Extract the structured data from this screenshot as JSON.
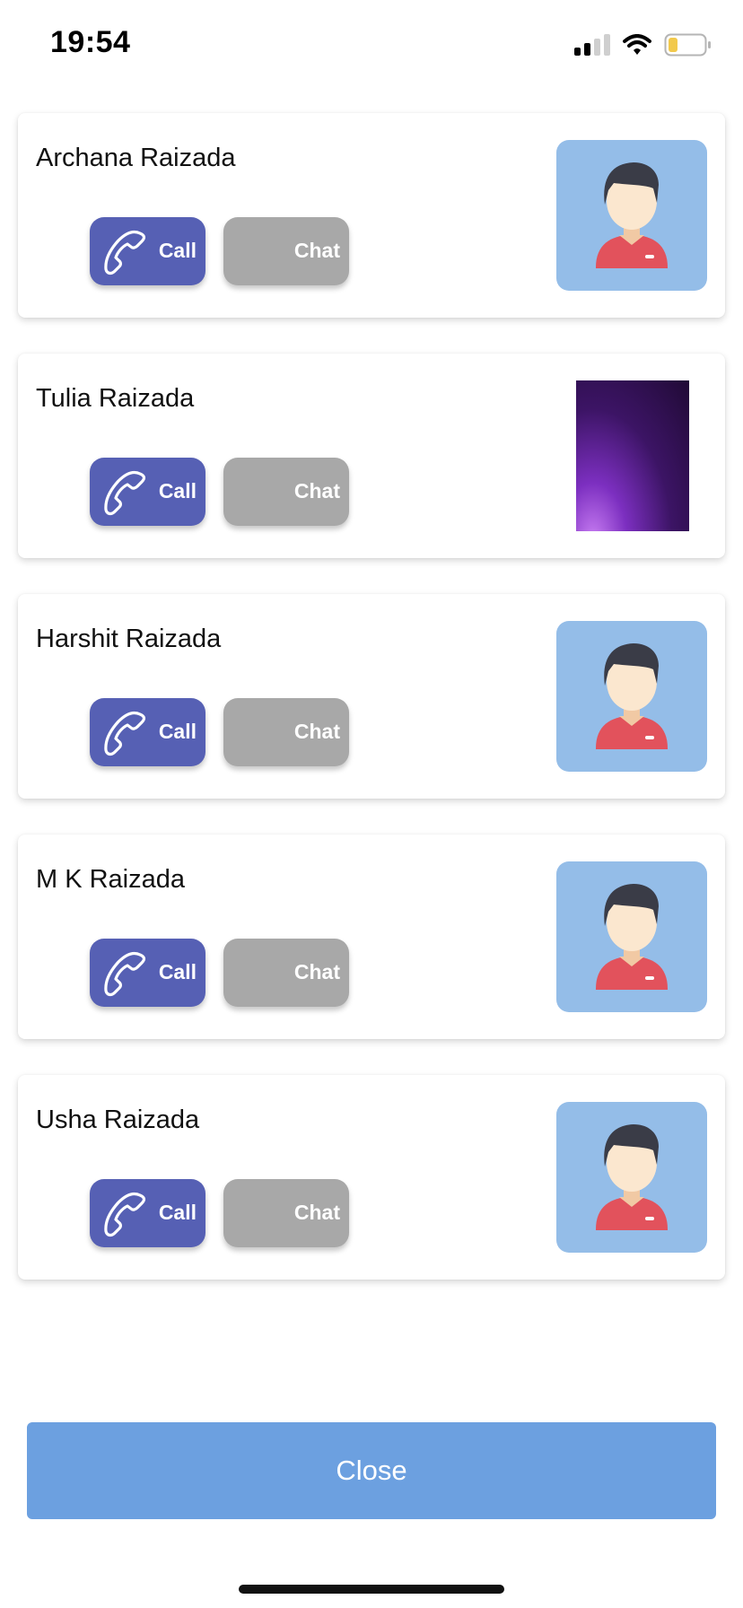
{
  "status_bar": {
    "time": "19:54",
    "signal_icon": "cellular-signal-icon",
    "wifi_icon": "wifi-icon",
    "battery_icon": "battery-low-icon",
    "battery_fill_fraction": 0.25,
    "battery_color": "#f2c94c"
  },
  "contacts": [
    {
      "name": "Archana Raizada",
      "call_label": "Call",
      "chat_label": "Chat",
      "image": "default-avatar"
    },
    {
      "name": "Tulia Raizada",
      "call_label": "Call",
      "chat_label": "Chat",
      "image": "purple-photo"
    },
    {
      "name": "Harshit Raizada",
      "call_label": "Call",
      "chat_label": "Chat",
      "image": "default-avatar"
    },
    {
      "name": "M K Raizada",
      "call_label": "Call",
      "chat_label": "Chat",
      "image": "default-avatar"
    },
    {
      "name": "Usha Raizada",
      "call_label": "Call",
      "chat_label": "Chat",
      "image": "default-avatar"
    }
  ],
  "close_button": {
    "label": "Close"
  },
  "colors": {
    "call_button": "#5660b4",
    "chat_button": "#a8a8a8",
    "close_button": "#6ca0e0",
    "avatar_bg": "#94bde8"
  }
}
